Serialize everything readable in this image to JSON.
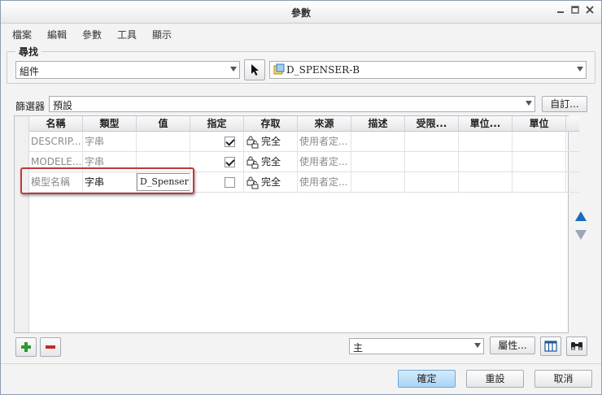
{
  "window": {
    "title": "參數",
    "controls": [
      "minimize-icon",
      "maximize-icon",
      "close-icon"
    ]
  },
  "menu": [
    "檔案",
    "編輯",
    "參數",
    "工具",
    "顯示"
  ],
  "search": {
    "label": "尋找",
    "scope": "組件",
    "object": "D_SPENSER-B",
    "pick_icon": "cursor-arrow-icon",
    "object_icon": "assembly-icon"
  },
  "filter": {
    "label": "篩選器",
    "value": "預設",
    "customize": "自訂..."
  },
  "table": {
    "columns": [
      "名稱",
      "類型",
      "值",
      "指定",
      "存取",
      "來源",
      "描述",
      "受限...",
      "單位...",
      "單位"
    ],
    "rows": [
      {
        "name": "DESCRIP...",
        "type": "字串",
        "value": "",
        "designate": true,
        "access": "完全",
        "source": "使用者定..."
      },
      {
        "name": "MODELE...",
        "type": "字串",
        "value": "",
        "designate": true,
        "access": "完全",
        "source": "使用者定..."
      },
      {
        "name": "模型名稱",
        "type": "字串",
        "value": "D_Spenser",
        "designate": false,
        "access": "完全",
        "source": "使用者定..."
      }
    ]
  },
  "bottom": {
    "add_icon": "plus-icon",
    "remove_icon": "minus-icon",
    "view_select": "主",
    "properties": "屬性...",
    "table_icon": "table-columns-icon",
    "find_icon": "binoculars-icon"
  },
  "side": {
    "up_icon": "triangle-up-icon",
    "down_icon": "triangle-down-icon"
  },
  "footer": {
    "ok": "確定",
    "reset": "重設",
    "cancel": "取消"
  },
  "colors": {
    "accent": "#1a6bb8",
    "highlight_border": "#c0393b",
    "add_green": "#2e9a2e",
    "remove_red": "#c62828"
  }
}
